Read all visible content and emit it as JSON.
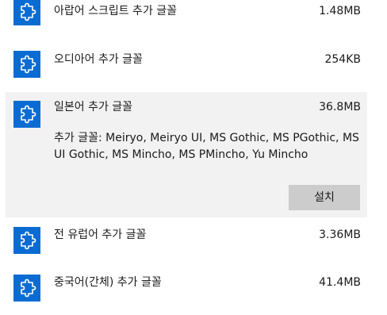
{
  "features": [
    {
      "name": "아랍어 스크립트 추가 글꼴",
      "size": "1.48MB",
      "icon": "puzzle-piece-icon"
    },
    {
      "name": "오디아어 추가 글꼴",
      "size": "254KB",
      "icon": "puzzle-piece-icon"
    },
    {
      "name": "일본어 추가 글꼴",
      "size": "36.8MB",
      "icon": "puzzle-piece-icon",
      "description": "추가 글꼴: Meiryo, Meiryo UI, MS Gothic, MS PGothic, MS UI Gothic, MS Mincho, MS PMincho, Yu Mincho",
      "install_label": "설치"
    },
    {
      "name": "전 유럽어 추가 글꼴",
      "size": "3.36MB",
      "icon": "puzzle-piece-icon"
    },
    {
      "name": "중국어(간체) 추가 글꼴",
      "size": "41.4MB",
      "icon": "puzzle-piece-icon"
    }
  ],
  "colors": {
    "icon_tile": "#0a6cd2",
    "expanded_background": "#f2f2f2",
    "button_background": "#cccccc"
  }
}
